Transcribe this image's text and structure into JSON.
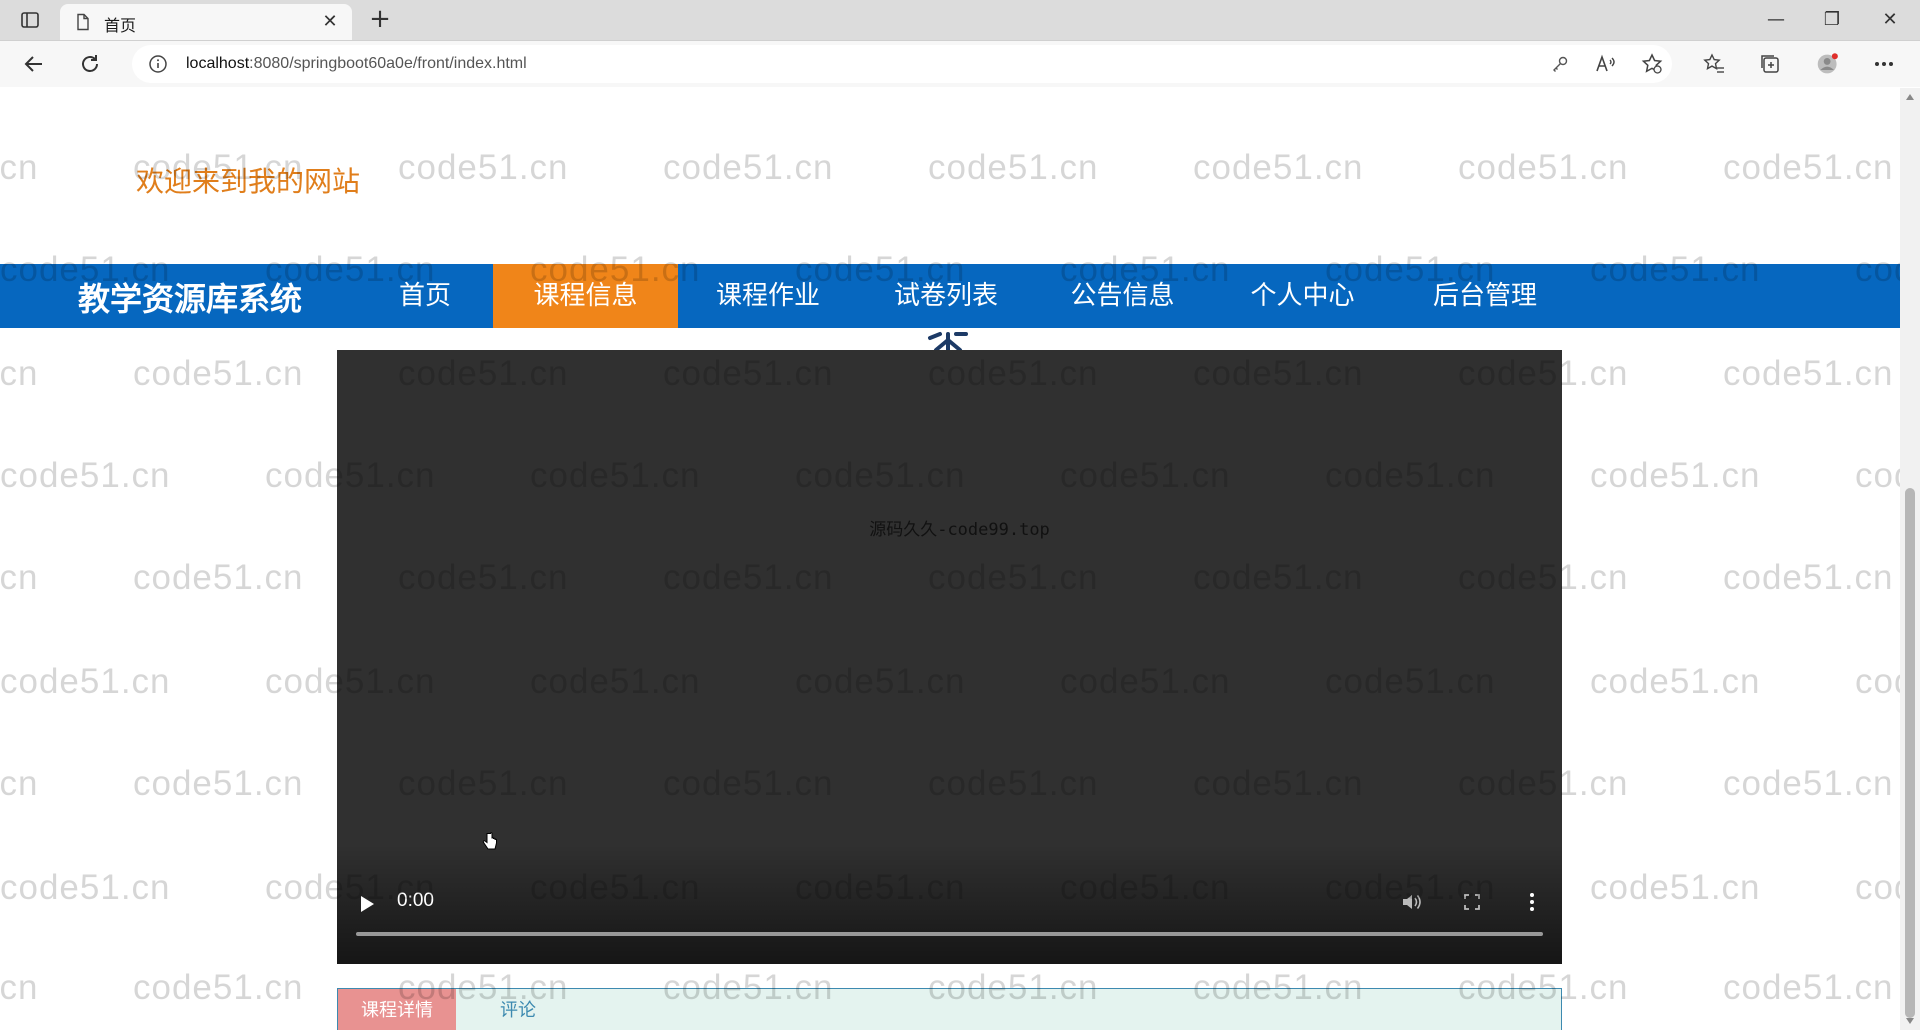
{
  "browser": {
    "tab_title": "首页",
    "new_tab_symbol": "+",
    "url_host": "localhost",
    "url_rest": ":8080/springboot60a0e/front/index.html",
    "window_controls": [
      "—",
      "❐",
      "✕"
    ]
  },
  "page": {
    "welcome": "欢迎来到我的网站",
    "brand": "教学资源库系统",
    "nav": [
      "首页",
      "课程信息",
      "课程作业",
      "试卷列表",
      "公告信息",
      "个人中心",
      "后台管理"
    ],
    "active_nav": "课程信息"
  },
  "video": {
    "overlay_text": "源码久久-code99.top",
    "time": "0:00",
    "progress": 0.0
  },
  "detail_tabs": {
    "active": "课程详情",
    "inactive": "评论"
  },
  "watermark": "code51.cn",
  "colors": {
    "nav_bg": "#0667bf",
    "nav_active": "#f08519",
    "welcome": "#e07e1b",
    "video_bg": "#303030",
    "tab_active": "#e89291"
  }
}
